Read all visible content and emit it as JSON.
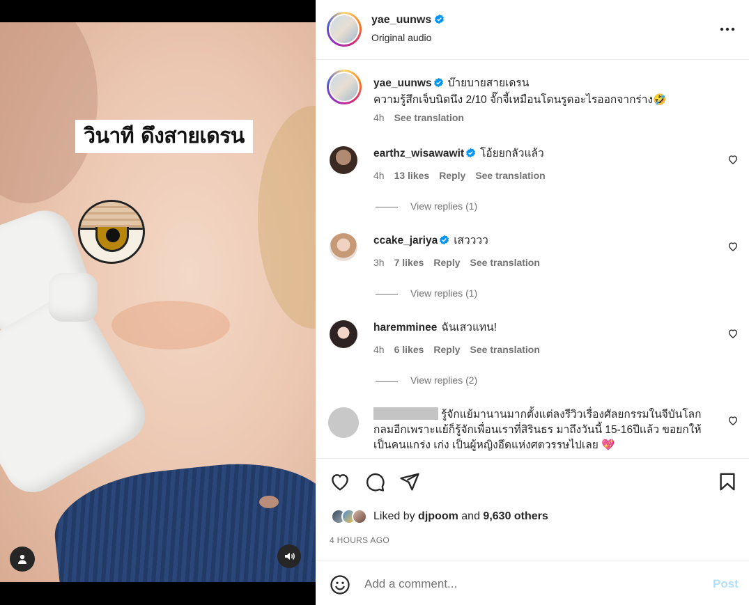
{
  "media": {
    "overlay_caption": "วินาที ดึงสายเดรน",
    "icons": [
      "person-tag-icon",
      "sound-icon"
    ]
  },
  "header": {
    "username": "yae_uunws",
    "verified": true,
    "audio": "Original audio",
    "more_icon": "more-options-icon"
  },
  "caption": {
    "username": "yae_uunws",
    "line1": "บ๊ายบายสายเดรน",
    "line2": "ความรู้สึกเจ็บนิดนึง 2/10 จั๊กจี้เหมือนโดนรูดอะไรออกจากร่าง🤣",
    "time": "4h",
    "see_translation": "See translation"
  },
  "comments": [
    {
      "username": "earthz_wisawawit",
      "verified": true,
      "text": "โอ้ยยกลัวแล้ว",
      "time": "4h",
      "likes": "13 likes",
      "reply": "Reply",
      "see_translation": "See translation",
      "view_replies": "View replies (1)"
    },
    {
      "username": "ccake_jariya",
      "verified": true,
      "text": "เสวววว",
      "time": "3h",
      "likes": "7 likes",
      "reply": "Reply",
      "see_translation": "See translation",
      "view_replies": "View replies (1)"
    },
    {
      "username": "haremminee",
      "verified": false,
      "text": "ฉันเสวแทน!",
      "time": "4h",
      "likes": "6 likes",
      "reply": "Reply",
      "see_translation": "See translation",
      "view_replies": "View replies (2)"
    },
    {
      "username": "",
      "verified": false,
      "redacted": true,
      "text": "รู้จักแย้มานานมากตั้งแต่ลงรีวิวเรื่องศัลยกรรมในจีบันโลกกลมอีกเพราะแย้ก็รู้จักเพื่อนเราที่สิรินธร มาถึงวันนี้ 15-16ปีแล้ว ขอยกให้เป็นคนแกร่ง เก่ง เป็นผู้หญิงอึดแห่งศตวรรษไปเลย 💖"
    }
  ],
  "actions": {
    "icons": [
      "heart-icon",
      "comment-icon",
      "share-icon",
      "bookmark-icon"
    ],
    "liked_by_prefix": "Liked by",
    "liked_by_user": "djpoom",
    "liked_by_and": "and",
    "liked_by_others": "9,630 others",
    "timestamp": "4 HOURS AGO"
  },
  "comment_box": {
    "placeholder": "Add a comment...",
    "post_label": "Post",
    "emoji_icon": "emoji-icon"
  },
  "colors": {
    "verified": "#0095f6",
    "secondary_text": "#737373",
    "post_disabled": "#b2dffc"
  }
}
